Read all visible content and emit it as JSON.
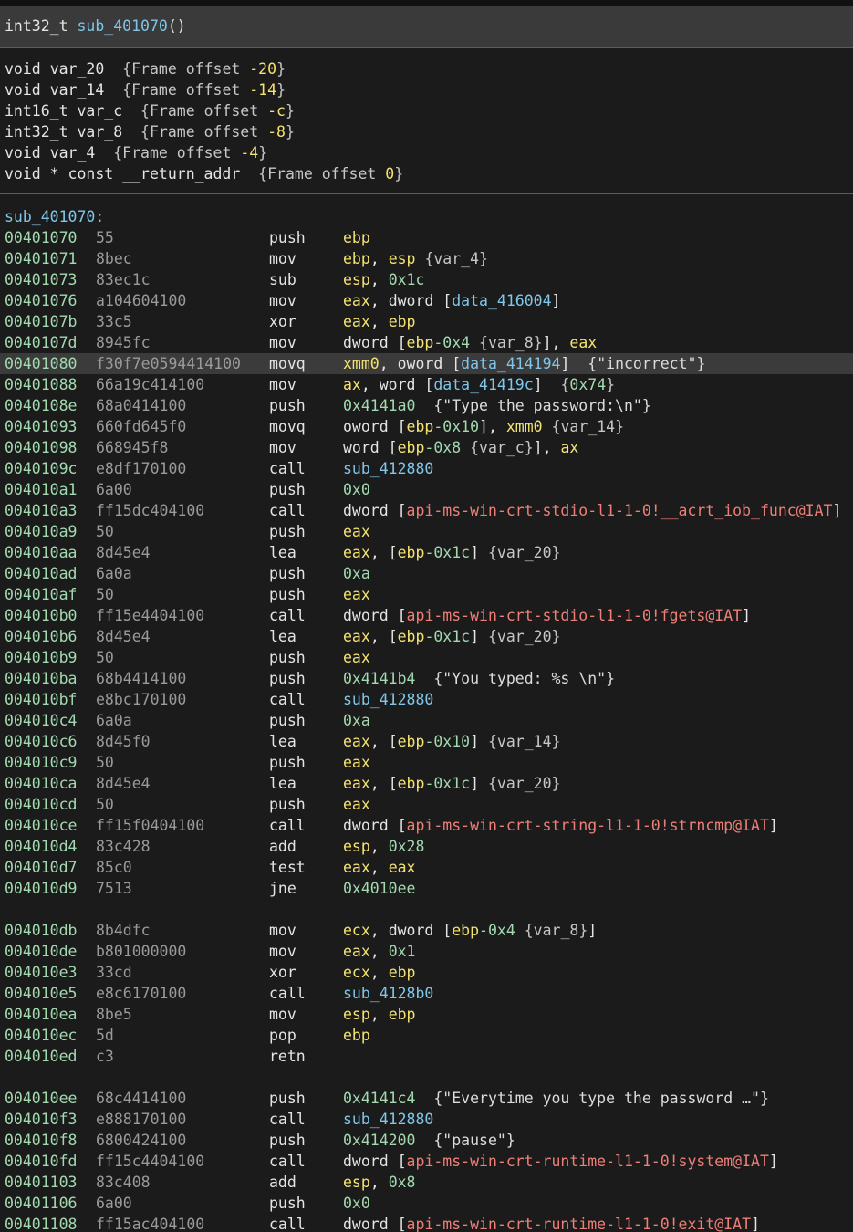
{
  "header": {
    "return_type": "int32_t",
    "function_name": "sub_401070",
    "params": "()"
  },
  "stack_vars": [
    {
      "type": "void",
      "name": "var_20",
      "pad": " ",
      "offset_label": "{Frame offset ",
      "offset": "-20",
      "close": "}"
    },
    {
      "type": "void",
      "name": "var_14",
      "pad": " ",
      "offset_label": "{Frame offset ",
      "offset": "-14",
      "close": "}"
    },
    {
      "type": "int16_t",
      "name": "var_c",
      "pad": " ",
      "offset_label": "{Frame offset ",
      "offset": "-c",
      "close": "}"
    },
    {
      "type": "int32_t",
      "name": "var_8",
      "pad": " ",
      "offset_label": "{Frame offset ",
      "offset": "-8",
      "close": "}"
    },
    {
      "type": "void",
      "name": "var_4",
      "pad": " ",
      "offset_label": "{Frame offset ",
      "offset": "-4",
      "close": "}"
    },
    {
      "type": "void * const",
      "name": "__return_addr",
      "pad": " ",
      "offset_label": "{Frame offset ",
      "offset": "0",
      "close": "}"
    }
  ],
  "listing": {
    "label": "sub_401070:",
    "rows": [
      {
        "addr": "00401070",
        "bytes": "55",
        "mnem": "push",
        "ops": [
          [
            "r",
            "ebp"
          ]
        ]
      },
      {
        "addr": "00401071",
        "bytes": "8bec",
        "mnem": "mov",
        "ops": [
          [
            "r",
            "ebp"
          ],
          [
            "p",
            ", "
          ],
          [
            "r",
            "esp"
          ],
          [
            "p",
            " "
          ],
          [
            "v",
            "{var_4}"
          ]
        ]
      },
      {
        "addr": "00401073",
        "bytes": "83ec1c",
        "mnem": "sub",
        "ops": [
          [
            "r",
            "esp"
          ],
          [
            "p",
            ", "
          ],
          [
            "n",
            "0x1c"
          ]
        ]
      },
      {
        "addr": "00401076",
        "bytes": "a104604100",
        "mnem": "mov",
        "ops": [
          [
            "r",
            "eax"
          ],
          [
            "p",
            ", "
          ],
          [
            "k",
            "dword ["
          ],
          [
            "d",
            "data_416004"
          ],
          [
            "k",
            "]"
          ]
        ]
      },
      {
        "addr": "0040107b",
        "bytes": "33c5",
        "mnem": "xor",
        "ops": [
          [
            "r",
            "eax"
          ],
          [
            "p",
            ", "
          ],
          [
            "r",
            "ebp"
          ]
        ]
      },
      {
        "addr": "0040107d",
        "bytes": "8945fc",
        "mnem": "mov",
        "ops": [
          [
            "k",
            "dword ["
          ],
          [
            "r",
            "ebp"
          ],
          [
            "n",
            "-0x4"
          ],
          [
            "p",
            " "
          ],
          [
            "v",
            "{var_8}"
          ],
          [
            "k",
            "]"
          ],
          [
            "p",
            ", "
          ],
          [
            "r",
            "eax"
          ]
        ]
      },
      {
        "addr": "00401080",
        "bytes": "f30f7e0594414100",
        "mnem": "movq",
        "hl": true,
        "ops": [
          [
            "r",
            "xmm0"
          ],
          [
            "p",
            ", "
          ],
          [
            "k",
            "oword ["
          ],
          [
            "d",
            "data_414194"
          ],
          [
            "k",
            "]"
          ],
          [
            "p",
            "  "
          ],
          [
            "c",
            "{\"incorrect\"}"
          ]
        ]
      },
      {
        "addr": "00401088",
        "bytes": "66a19c414100",
        "mnem": "mov",
        "ops": [
          [
            "r",
            "ax"
          ],
          [
            "p",
            ", "
          ],
          [
            "k",
            "word ["
          ],
          [
            "d",
            "data_41419c"
          ],
          [
            "k",
            "]"
          ],
          [
            "p",
            "  "
          ],
          [
            "v",
            "{"
          ],
          [
            "n",
            "0x74"
          ],
          [
            "v",
            "}"
          ]
        ]
      },
      {
        "addr": "0040108e",
        "bytes": "68a0414100",
        "mnem": "push",
        "ops": [
          [
            "n",
            "0x4141a0"
          ],
          [
            "p",
            "  "
          ],
          [
            "c",
            "{\"Type the password:\\n\"}"
          ]
        ]
      },
      {
        "addr": "00401093",
        "bytes": "660fd645f0",
        "mnem": "movq",
        "ops": [
          [
            "k",
            "oword ["
          ],
          [
            "r",
            "ebp"
          ],
          [
            "n",
            "-0x10"
          ],
          [
            "k",
            "]"
          ],
          [
            "p",
            ", "
          ],
          [
            "r",
            "xmm0"
          ],
          [
            "p",
            " "
          ],
          [
            "v",
            "{var_14}"
          ]
        ]
      },
      {
        "addr": "00401098",
        "bytes": "668945f8",
        "mnem": "mov",
        "ops": [
          [
            "k",
            "word ["
          ],
          [
            "r",
            "ebp"
          ],
          [
            "n",
            "-0x8"
          ],
          [
            "p",
            " "
          ],
          [
            "v",
            "{var_c}"
          ],
          [
            "k",
            "]"
          ],
          [
            "p",
            ", "
          ],
          [
            "r",
            "ax"
          ]
        ]
      },
      {
        "addr": "0040109c",
        "bytes": "e8df170100",
        "mnem": "call",
        "ops": [
          [
            "s",
            "sub_412880"
          ]
        ]
      },
      {
        "addr": "004010a1",
        "bytes": "6a00",
        "mnem": "push",
        "ops": [
          [
            "n",
            "0x0"
          ]
        ]
      },
      {
        "addr": "004010a3",
        "bytes": "ff15dc404100",
        "mnem": "call",
        "ops": [
          [
            "k",
            "dword ["
          ],
          [
            "i",
            "api-ms-win-crt-stdio-l1-1-0!__acrt_iob_func@IAT"
          ],
          [
            "k",
            "]"
          ]
        ]
      },
      {
        "addr": "004010a9",
        "bytes": "50",
        "mnem": "push",
        "ops": [
          [
            "r",
            "eax"
          ]
        ]
      },
      {
        "addr": "004010aa",
        "bytes": "8d45e4",
        "mnem": "lea",
        "ops": [
          [
            "r",
            "eax"
          ],
          [
            "p",
            ", "
          ],
          [
            "k",
            "["
          ],
          [
            "r",
            "ebp"
          ],
          [
            "n",
            "-0x1c"
          ],
          [
            "k",
            "]"
          ],
          [
            "p",
            " "
          ],
          [
            "v",
            "{var_20}"
          ]
        ]
      },
      {
        "addr": "004010ad",
        "bytes": "6a0a",
        "mnem": "push",
        "ops": [
          [
            "n",
            "0xa"
          ]
        ]
      },
      {
        "addr": "004010af",
        "bytes": "50",
        "mnem": "push",
        "ops": [
          [
            "r",
            "eax"
          ]
        ]
      },
      {
        "addr": "004010b0",
        "bytes": "ff15e4404100",
        "mnem": "call",
        "ops": [
          [
            "k",
            "dword ["
          ],
          [
            "i",
            "api-ms-win-crt-stdio-l1-1-0!fgets@IAT"
          ],
          [
            "k",
            "]"
          ]
        ]
      },
      {
        "addr": "004010b6",
        "bytes": "8d45e4",
        "mnem": "lea",
        "ops": [
          [
            "r",
            "eax"
          ],
          [
            "p",
            ", "
          ],
          [
            "k",
            "["
          ],
          [
            "r",
            "ebp"
          ],
          [
            "n",
            "-0x1c"
          ],
          [
            "k",
            "]"
          ],
          [
            "p",
            " "
          ],
          [
            "v",
            "{var_20}"
          ]
        ]
      },
      {
        "addr": "004010b9",
        "bytes": "50",
        "mnem": "push",
        "ops": [
          [
            "r",
            "eax"
          ]
        ]
      },
      {
        "addr": "004010ba",
        "bytes": "68b4414100",
        "mnem": "push",
        "ops": [
          [
            "n",
            "0x4141b4"
          ],
          [
            "p",
            "  "
          ],
          [
            "c",
            "{\"You typed: %s \\n\"}"
          ]
        ]
      },
      {
        "addr": "004010bf",
        "bytes": "e8bc170100",
        "mnem": "call",
        "ops": [
          [
            "s",
            "sub_412880"
          ]
        ]
      },
      {
        "addr": "004010c4",
        "bytes": "6a0a",
        "mnem": "push",
        "ops": [
          [
            "n",
            "0xa"
          ]
        ]
      },
      {
        "addr": "004010c6",
        "bytes": "8d45f0",
        "mnem": "lea",
        "ops": [
          [
            "r",
            "eax"
          ],
          [
            "p",
            ", "
          ],
          [
            "k",
            "["
          ],
          [
            "r",
            "ebp"
          ],
          [
            "n",
            "-0x10"
          ],
          [
            "k",
            "]"
          ],
          [
            "p",
            " "
          ],
          [
            "v",
            "{var_14}"
          ]
        ]
      },
      {
        "addr": "004010c9",
        "bytes": "50",
        "mnem": "push",
        "ops": [
          [
            "r",
            "eax"
          ]
        ]
      },
      {
        "addr": "004010ca",
        "bytes": "8d45e4",
        "mnem": "lea",
        "ops": [
          [
            "r",
            "eax"
          ],
          [
            "p",
            ", "
          ],
          [
            "k",
            "["
          ],
          [
            "r",
            "ebp"
          ],
          [
            "n",
            "-0x1c"
          ],
          [
            "k",
            "]"
          ],
          [
            "p",
            " "
          ],
          [
            "v",
            "{var_20}"
          ]
        ]
      },
      {
        "addr": "004010cd",
        "bytes": "50",
        "mnem": "push",
        "ops": [
          [
            "r",
            "eax"
          ]
        ]
      },
      {
        "addr": "004010ce",
        "bytes": "ff15f0404100",
        "mnem": "call",
        "ops": [
          [
            "k",
            "dword ["
          ],
          [
            "i",
            "api-ms-win-crt-string-l1-1-0!strncmp@IAT"
          ],
          [
            "k",
            "]"
          ]
        ]
      },
      {
        "addr": "004010d4",
        "bytes": "83c428",
        "mnem": "add",
        "ops": [
          [
            "r",
            "esp"
          ],
          [
            "p",
            ", "
          ],
          [
            "n",
            "0x28"
          ]
        ]
      },
      {
        "addr": "004010d7",
        "bytes": "85c0",
        "mnem": "test",
        "ops": [
          [
            "r",
            "eax"
          ],
          [
            "p",
            ", "
          ],
          [
            "r",
            "eax"
          ]
        ]
      },
      {
        "addr": "004010d9",
        "bytes": "7513",
        "mnem": "jne",
        "ops": [
          [
            "n",
            "0x4010ee"
          ]
        ]
      },
      {
        "gap": true
      },
      {
        "addr": "004010db",
        "bytes": "8b4dfc",
        "mnem": "mov",
        "ops": [
          [
            "r",
            "ecx"
          ],
          [
            "p",
            ", "
          ],
          [
            "k",
            "dword ["
          ],
          [
            "r",
            "ebp"
          ],
          [
            "n",
            "-0x4"
          ],
          [
            "p",
            " "
          ],
          [
            "v",
            "{var_8}"
          ],
          [
            "k",
            "]"
          ]
        ]
      },
      {
        "addr": "004010de",
        "bytes": "b801000000",
        "mnem": "mov",
        "ops": [
          [
            "r",
            "eax"
          ],
          [
            "p",
            ", "
          ],
          [
            "n",
            "0x1"
          ]
        ]
      },
      {
        "addr": "004010e3",
        "bytes": "33cd",
        "mnem": "xor",
        "ops": [
          [
            "r",
            "ecx"
          ],
          [
            "p",
            ", "
          ],
          [
            "r",
            "ebp"
          ]
        ]
      },
      {
        "addr": "004010e5",
        "bytes": "e8c6170100",
        "mnem": "call",
        "ops": [
          [
            "s",
            "sub_4128b0"
          ]
        ]
      },
      {
        "addr": "004010ea",
        "bytes": "8be5",
        "mnem": "mov",
        "ops": [
          [
            "r",
            "esp"
          ],
          [
            "p",
            ", "
          ],
          [
            "r",
            "ebp"
          ]
        ]
      },
      {
        "addr": "004010ec",
        "bytes": "5d",
        "mnem": "pop",
        "ops": [
          [
            "r",
            "ebp"
          ]
        ]
      },
      {
        "addr": "004010ed",
        "bytes": "c3",
        "mnem": "retn",
        "ops": []
      },
      {
        "gap": true
      },
      {
        "addr": "004010ee",
        "bytes": "68c4414100",
        "mnem": "push",
        "ops": [
          [
            "n",
            "0x4141c4"
          ],
          [
            "p",
            "  "
          ],
          [
            "c",
            "{\"Everytime you type the password …\"}"
          ]
        ]
      },
      {
        "addr": "004010f3",
        "bytes": "e888170100",
        "mnem": "call",
        "ops": [
          [
            "s",
            "sub_412880"
          ]
        ]
      },
      {
        "addr": "004010f8",
        "bytes": "6800424100",
        "mnem": "push",
        "ops": [
          [
            "n",
            "0x414200"
          ],
          [
            "p",
            "  "
          ],
          [
            "c",
            "{\"pause\"}"
          ]
        ]
      },
      {
        "addr": "004010fd",
        "bytes": "ff15c4404100",
        "mnem": "call",
        "ops": [
          [
            "k",
            "dword ["
          ],
          [
            "i",
            "api-ms-win-crt-runtime-l1-1-0!system@IAT"
          ],
          [
            "k",
            "]"
          ]
        ]
      },
      {
        "addr": "00401103",
        "bytes": "83c408",
        "mnem": "add",
        "ops": [
          [
            "r",
            "esp"
          ],
          [
            "p",
            ", "
          ],
          [
            "n",
            "0x8"
          ]
        ]
      },
      {
        "addr": "00401106",
        "bytes": "6a00",
        "mnem": "push",
        "ops": [
          [
            "n",
            "0x0"
          ]
        ]
      },
      {
        "addr": "00401108",
        "bytes": "ff15ac404100",
        "mnem": "call",
        "ops": [
          [
            "k",
            "dword ["
          ],
          [
            "i",
            "api-ms-win-crt-runtime-l1-1-0!exit@IAT"
          ],
          [
            "k",
            "]"
          ]
        ]
      }
    ]
  },
  "colors": {
    "background": "#1b1b1b",
    "header_bg": "#3a3a3a",
    "highlight_row": "#3b3b3b",
    "address": "#a2d9af",
    "bytes": "#9a9a9a",
    "register": "#f4e270",
    "number": "#a2d9af",
    "symbol": "#80c6e9",
    "import": "#ee7f77"
  }
}
